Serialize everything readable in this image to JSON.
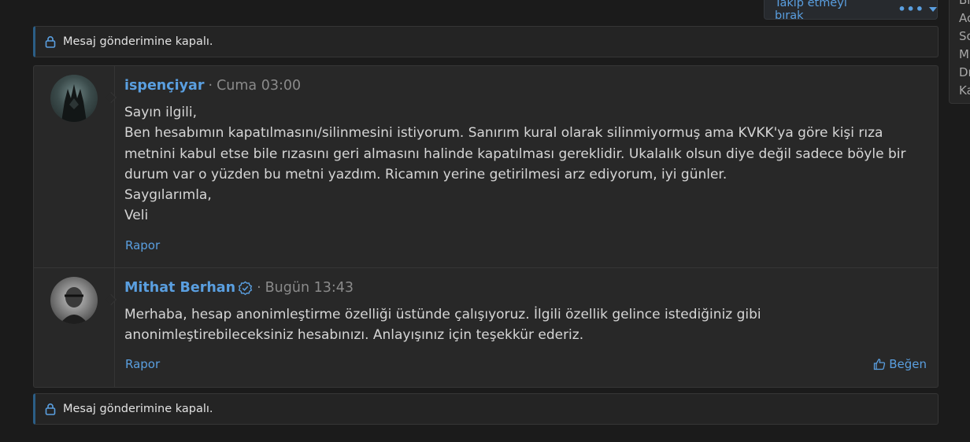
{
  "header": {
    "follow_label": "Takip etmeyi bırak",
    "more_label": "•••"
  },
  "right_panel": {
    "fragments": [
      "Bı",
      "Ac",
      "So",
      "M",
      "Dı",
      "Ka"
    ]
  },
  "notices": {
    "top": "Mesaj gönderimine kapalı.",
    "bottom": "Mesaj gönderimine kapalı."
  },
  "posts": [
    {
      "username": "ispençiyar",
      "separator": "·",
      "time": "Cuma 03:00",
      "lines": [
        "Sayın ilgili,",
        "Ben hesabımın kapatılmasını/silinmesini istiyorum. Sanırım kural olarak silinmiyormuş ama KVKK'ya göre kişi rıza metnini kabul etse bile rızasını geri almasını halinde kapatılması gereklidir. Ukalalık olsun diye değil sadece böyle bir durum var o yüzden bu metni yazdım. Ricamın yerine getirilmesi arz ediyorum, iyi günler.",
        "Saygılarımla,",
        "Veli"
      ],
      "report_label": "Rapor"
    },
    {
      "username": "Mithat Berhan",
      "separator": "·",
      "time": "Bugün 13:43",
      "lines": [
        "Merhaba, hesap anonimleştirme özelliği üstünde çalışıyoruz. İlgili özellik gelince istediğiniz gibi anonimleştirebileceksiniz hesabınızı. Anlayışınız için teşekkür ederiz."
      ],
      "report_label": "Rapor",
      "like_label": "Beğen"
    }
  ],
  "colors": {
    "accent": "#5a9fe0",
    "background": "#1b1b1b",
    "panel": "#282828",
    "muted": "#8a8a8a"
  }
}
